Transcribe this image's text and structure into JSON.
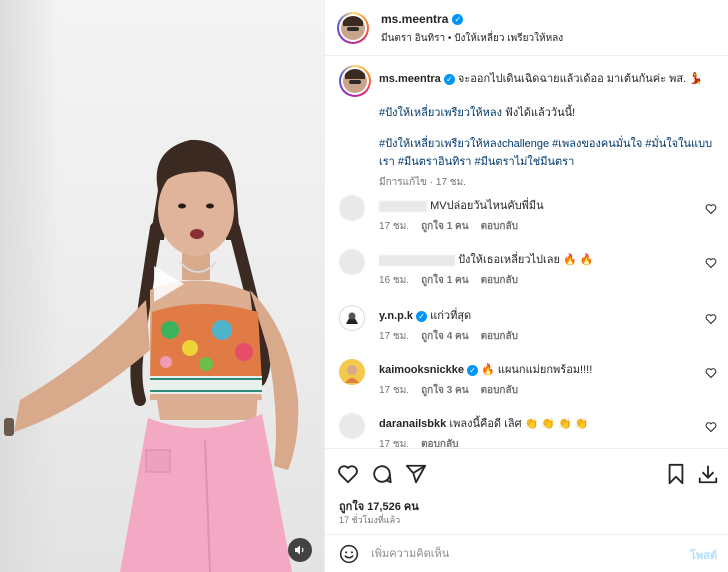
{
  "header": {
    "username": "ms.meentra",
    "subtitle": "มีนตรา อินทิรา • ปังให้เหลี่ยว เพรียวให้หลง"
  },
  "caption": {
    "username": "ms.meentra",
    "text": "จะออกไปเดินเฉิดฉายแล้วเด้ออ มาเต้นกันค่ะ พส. 💃",
    "tag_line1": "#ปังให้เหลี่ยวเพรียวให้หลง",
    "tag_line1_suffix": " ฟังได้แล้ววันนี้!",
    "tags_line2": "#ปังให้เหลี่ยวเพรียวให้หลงchallenge #เพลงของคนมั่นใจ #มั่นใจในแบบเรา #มีนตราอินทิรา #มีนตราไม่ใช่มีนตรา",
    "meta": "มีการแก้ไข · 17 ชม."
  },
  "comments": [
    {
      "username": "",
      "text": "MVปล่อยวันไหนคับพี่มีน",
      "time": "17 ชม.",
      "likes": "ถูกใจ 1 คน",
      "reply": "ตอบกลับ"
    },
    {
      "username": "",
      "text": "ปังให้เธอเหลี่ยวไปเลย 🔥 🔥",
      "time": "16 ชม.",
      "likes": "ถูกใจ 1 คน",
      "reply": "ตอบกลับ"
    },
    {
      "username": "y.n.p.k",
      "text": "แก่วที่สุด",
      "time": "17 ชม.",
      "likes": "ถูกใจ 4 คน",
      "reply": "ตอบกลับ"
    },
    {
      "username": "kaimooksnickke",
      "text": "🔥 แผนกแม่ยกพร้อม!!!!",
      "time": "17 ชม.",
      "likes": "ถูกใจ 3 คน",
      "reply": "ตอบกลับ"
    },
    {
      "username": "daranailsbkk",
      "text": "เพลงนี้คือดี เลิศ 👏 👏 👏 👏",
      "time": "17 ชม.",
      "likes": "",
      "reply": "ตอบกลับ"
    }
  ],
  "actions": {
    "likes": "ถูกใจ 17,526 คน",
    "time": "17 ชั่วโมงที่แล้ว"
  },
  "compose": {
    "placeholder": "เพิ่มความคิดเห็น",
    "post_label": "โพสต์"
  },
  "colors": {
    "link": "#00376b",
    "verified": "#0095f6",
    "post_disabled": "#b2dffc"
  },
  "icons": [
    "play-icon",
    "speaker-icon",
    "verified-icon",
    "heart-icon",
    "comment-icon",
    "share-icon",
    "bookmark-icon",
    "download-icon",
    "emoji-icon"
  ]
}
